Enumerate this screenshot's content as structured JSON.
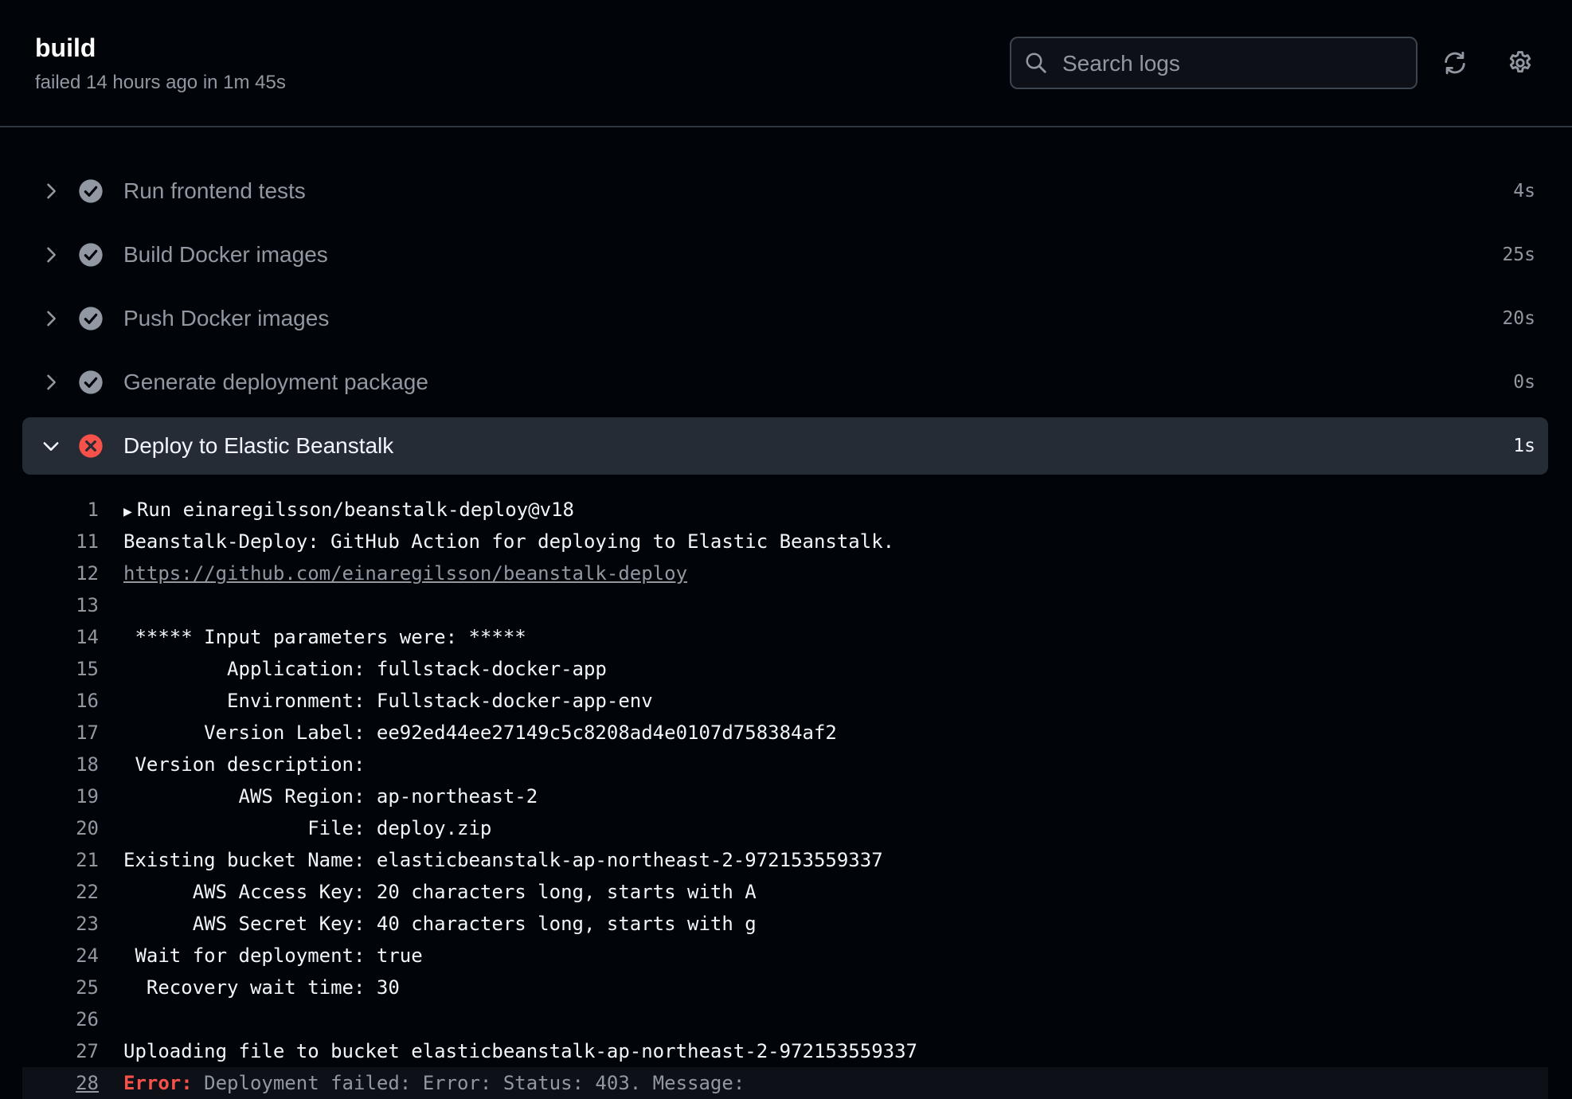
{
  "header": {
    "title": "build",
    "subtitle": "failed 14 hours ago in 1m 45s",
    "search_placeholder": "Search logs"
  },
  "steps": [
    {
      "name": "Run frontend tests",
      "duration": "4s",
      "status": "success"
    },
    {
      "name": "Build Docker images",
      "duration": "25s",
      "status": "success"
    },
    {
      "name": "Push Docker images",
      "duration": "20s",
      "status": "success"
    },
    {
      "name": "Generate deployment package",
      "duration": "0s",
      "status": "success"
    },
    {
      "name": "Deploy to Elastic Beanstalk",
      "duration": "1s",
      "status": "failure",
      "expanded": true
    }
  ],
  "log": {
    "lines": [
      {
        "n": "1",
        "text": "Run einaregilsson/beanstalk-deploy@v18",
        "caret": "▶"
      },
      {
        "n": "11",
        "text": "Beanstalk-Deploy: GitHub Action for deploying to Elastic Beanstalk."
      },
      {
        "n": "12",
        "text": "https://github.com/einaregilsson/beanstalk-deploy",
        "link": true
      },
      {
        "n": "13",
        "text": ""
      },
      {
        "n": "14",
        "text": " ***** Input parameters were: *****"
      },
      {
        "n": "15",
        "text": "         Application: fullstack-docker-app"
      },
      {
        "n": "16",
        "text": "         Environment: Fullstack-docker-app-env"
      },
      {
        "n": "17",
        "text": "       Version Label: ee92ed44ee27149c5c8208ad4e0107d758384af2"
      },
      {
        "n": "18",
        "text": " Version description: "
      },
      {
        "n": "19",
        "text": "          AWS Region: ap-northeast-2"
      },
      {
        "n": "20",
        "text": "                File: deploy.zip"
      },
      {
        "n": "21",
        "text": "Existing bucket Name: elasticbeanstalk-ap-northeast-2-972153559337"
      },
      {
        "n": "22",
        "text": "      AWS Access Key: 20 characters long, starts with A"
      },
      {
        "n": "23",
        "text": "      AWS Secret Key: 40 characters long, starts with g"
      },
      {
        "n": "24",
        "text": " Wait for deployment: true"
      },
      {
        "n": "25",
        "text": "  Recovery wait time: 30"
      },
      {
        "n": "26",
        "text": ""
      },
      {
        "n": "27",
        "text": "Uploading file to bucket elasticbeanstalk-ap-northeast-2-972153559337"
      }
    ],
    "error_line": {
      "n": "28",
      "label": "Error:",
      "text": " Deployment failed: Error: Status: 403. Message:"
    }
  },
  "colors": {
    "background": "#010409",
    "success": "#9198a1",
    "failure": "#f85149",
    "expanded_row": "#262c36"
  },
  "icons": {
    "search": "search-icon",
    "refresh": "refresh-icon",
    "settings": "gear-icon",
    "chevron_right": "chevron-right-icon",
    "chevron_down": "chevron-down-icon",
    "success": "check-circle-icon",
    "failure": "x-circle-icon"
  }
}
